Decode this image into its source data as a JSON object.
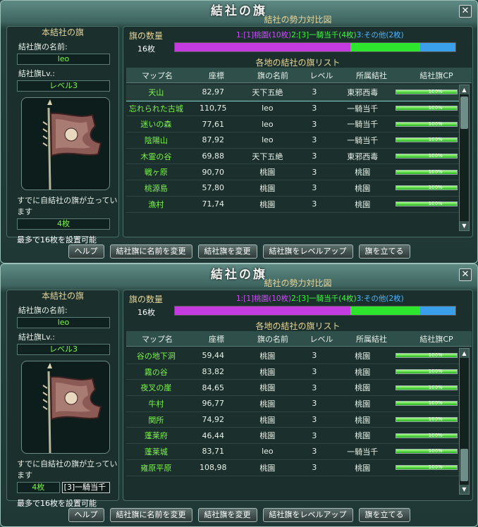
{
  "windows": [
    {
      "title": "結社の旗",
      "left": {
        "section_title": "本結社の旗",
        "name_label": "結社旗の名前:",
        "name_value": "leo",
        "level_label": "結社旗Lv.:",
        "level_value": "レベル3",
        "standing_label": "すでに自結社の旗が立っています",
        "standing_count": "4枚",
        "dropdown_value": "",
        "max_note": "最多で16枚を設置可能"
      },
      "right": {
        "section_title": "結社の勢力対比図",
        "count_label": "旗の数量",
        "legend": [
          {
            "text": "1:[1]桃園(10枚)",
            "color": "#d04cff"
          },
          {
            "text": "2:[3]一騎当千(4枚)",
            "color": "#39ff39"
          },
          {
            "text": "3:その他(2枚)",
            "color": "#4bb6ff"
          }
        ],
        "bar_label": "16枚",
        "bar_segments": [
          {
            "fraction": 0.625,
            "color": "#c43ce0"
          },
          {
            "fraction": 0.25,
            "color": "#2ce52c"
          },
          {
            "fraction": 0.125,
            "color": "#3aa0ea"
          }
        ],
        "list_title": "各地の結社の旗リスト",
        "columns": [
          "マップ名",
          "座標",
          "旗の名前",
          "レベル",
          "所属結社",
          "結社旗CP"
        ],
        "rows": [
          {
            "map": "天山",
            "coord": "82,97",
            "flag": "天下五絶",
            "level": "3",
            "guild": "東邪西毒",
            "cp": "100%",
            "selected": true
          },
          {
            "map": "忘れられた古城",
            "coord": "110,75",
            "flag": "leo",
            "level": "3",
            "guild": "一騎当千",
            "cp": "100%"
          },
          {
            "map": "迷いの森",
            "coord": "77,61",
            "flag": "leo",
            "level": "3",
            "guild": "一騎当千",
            "cp": "100%"
          },
          {
            "map": "陰陽山",
            "coord": "87,92",
            "flag": "leo",
            "level": "3",
            "guild": "一騎当千",
            "cp": "100%"
          },
          {
            "map": "木霊の谷",
            "coord": "69,88",
            "flag": "天下五絶",
            "level": "3",
            "guild": "東邪西毒",
            "cp": "100%"
          },
          {
            "map": "戦ヶ原",
            "coord": "90,70",
            "flag": "桃園",
            "level": "3",
            "guild": "桃園",
            "cp": "100%"
          },
          {
            "map": "桃源島",
            "coord": "57,80",
            "flag": "桃園",
            "level": "3",
            "guild": "桃園",
            "cp": "100%"
          },
          {
            "map": "漁村",
            "coord": "71,74",
            "flag": "桃園",
            "level": "3",
            "guild": "桃園",
            "cp": "100%"
          }
        ],
        "scroll_up": "▲",
        "scroll_down": "▼"
      },
      "buttons": [
        "ヘルプ",
        "結社旗に名前を変更",
        "結社旗を変更",
        "結社旗をレベルアップ",
        "旗を立てる"
      ]
    },
    {
      "title": "結社の旗",
      "left": {
        "section_title": "本結社の旗",
        "name_label": "結社旗の名前:",
        "name_value": "leo",
        "level_label": "結社旗Lv.:",
        "level_value": "レベル3",
        "standing_label": "すでに自結社の旗が立っています",
        "standing_count": "4枚",
        "dropdown_value": "[3]一騎当千",
        "max_note": "最多で16枚を設置可能"
      },
      "right": {
        "section_title": "結社の勢力対比図",
        "count_label": "旗の数量",
        "legend": [
          {
            "text": "1:[1]桃園(10枚)",
            "color": "#d04cff"
          },
          {
            "text": "2:[3]一騎当千(4枚)",
            "color": "#39ff39"
          },
          {
            "text": "3:その他(2枚)",
            "color": "#4bb6ff"
          }
        ],
        "bar_label": "16枚",
        "bar_segments": [
          {
            "fraction": 0.625,
            "color": "#c43ce0"
          },
          {
            "fraction": 0.25,
            "color": "#2ce52c"
          },
          {
            "fraction": 0.125,
            "color": "#3aa0ea"
          }
        ],
        "list_title": "各地の結社の旗リスト",
        "columns": [
          "マップ名",
          "座標",
          "旗の名前",
          "レベル",
          "所属結社",
          "結社旗CP"
        ],
        "rows": [
          {
            "map": "谷の地下洞",
            "coord": "59,44",
            "flag": "桃園",
            "level": "3",
            "guild": "桃園",
            "cp": "100%"
          },
          {
            "map": "霧の谷",
            "coord": "83,82",
            "flag": "桃園",
            "level": "3",
            "guild": "桃園",
            "cp": "100%"
          },
          {
            "map": "夜叉の崖",
            "coord": "84,65",
            "flag": "桃園",
            "level": "3",
            "guild": "桃園",
            "cp": "100%"
          },
          {
            "map": "牛村",
            "coord": "96,77",
            "flag": "桃園",
            "level": "3",
            "guild": "桃園",
            "cp": "100%"
          },
          {
            "map": "関所",
            "coord": "74,92",
            "flag": "桃園",
            "level": "3",
            "guild": "桃園",
            "cp": "100%"
          },
          {
            "map": "蓬莱府",
            "coord": "46,44",
            "flag": "桃園",
            "level": "3",
            "guild": "桃園",
            "cp": "100%"
          },
          {
            "map": "蓬莱城",
            "coord": "83,71",
            "flag": "leo",
            "level": "3",
            "guild": "一騎当千",
            "cp": "100%"
          },
          {
            "map": "雍原平原",
            "coord": "108,98",
            "flag": "桃園",
            "level": "3",
            "guild": "桃園",
            "cp": "100%"
          }
        ],
        "scroll_up": "▲",
        "scroll_down": "▼"
      },
      "buttons": [
        "ヘルプ",
        "結社旗に名前を変更",
        "結社旗を変更",
        "結社旗をレベルアップ",
        "旗を立てる"
      ]
    }
  ]
}
